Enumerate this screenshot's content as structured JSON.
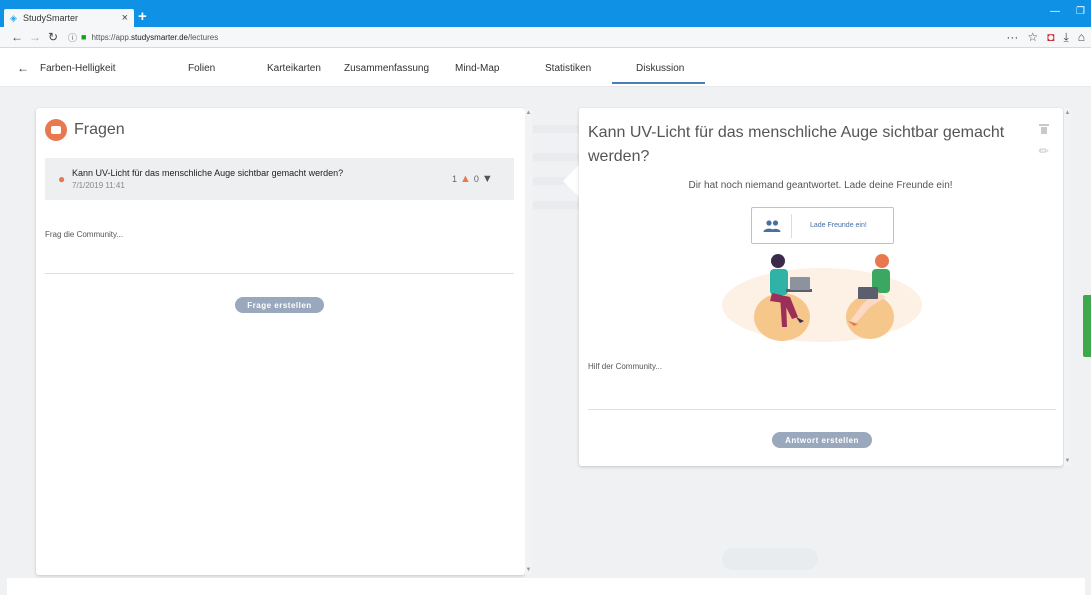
{
  "browser": {
    "tab_title": "StudySmarter",
    "tab_close": "×",
    "new_tab": "+",
    "url_prefix": "https://app.",
    "url_host": "studysmarter.de",
    "url_path": "/lectures"
  },
  "header": {
    "lecture": "Farben-Helligkeit",
    "tabs": [
      "Folien",
      "Karteikarten",
      "Zusammenfassung",
      "Mind-Map",
      "Statistiken",
      "Diskussion"
    ],
    "active_tab": "Diskussion"
  },
  "questions_panel": {
    "title": "Fragen",
    "items": [
      {
        "text": "Kann UV-Licht für das menschliche Auge sichtbar gemacht werden?",
        "date": "7/1/2019 11:41",
        "upvotes": "1",
        "downvotes": "0"
      }
    ],
    "input_placeholder": "Frag die Community...",
    "create_button": "Frage erstellen"
  },
  "detail_panel": {
    "title": "Kann UV-Licht für das menschliche Auge sichtbar gemacht werden?",
    "no_answer_text": "Dir hat noch niemand geantwortet. Lade deine Freunde ein!",
    "invite_button": "Lade Freunde ein!",
    "input_placeholder": "Hilf der Community...",
    "answer_button": "Antwort erstellen"
  },
  "colors": {
    "accent_orange": "#e8784f",
    "active_underline": "#4a7fb6",
    "button_gray": "#9aa8bd",
    "tabbar_blue": "#0f91e6"
  }
}
